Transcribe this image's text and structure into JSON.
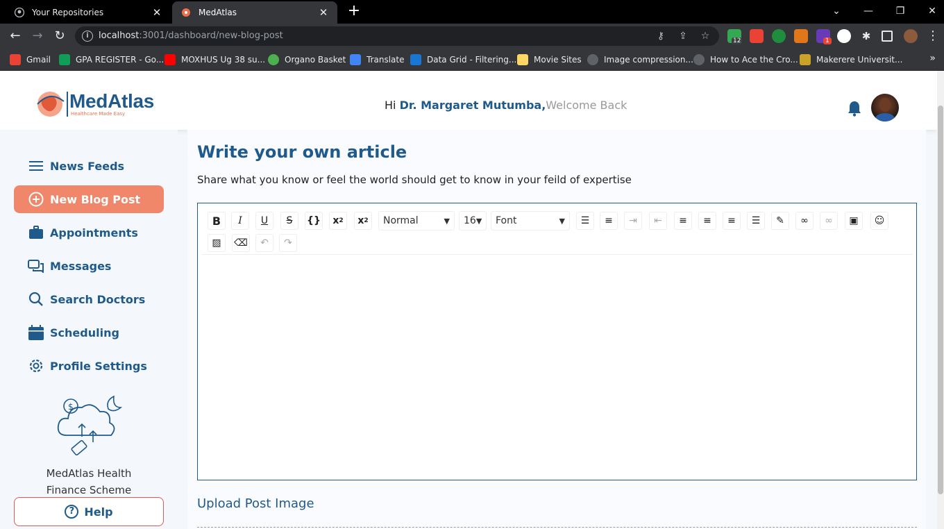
{
  "browser": {
    "tabs": [
      {
        "title": "Your Repositories"
      },
      {
        "title": "MedAtlas"
      }
    ],
    "url": {
      "host": "localhost",
      "rest": ":3001/dashboard/new-blog-post"
    },
    "bookmarks": [
      {
        "label": "Gmail",
        "color": "#ea4335"
      },
      {
        "label": "GPA REGISTER - Go...",
        "color": "#0f9d58"
      },
      {
        "label": "MOXHUS Ug 38 su...",
        "color": "#ff0000"
      },
      {
        "label": "Organo Basket",
        "color": "#4caf50"
      },
      {
        "label": "Translate",
        "color": "#4285f4"
      },
      {
        "label": "Data Grid - Filtering...",
        "color": "#1976d2"
      },
      {
        "label": "Movie Sites",
        "color": "#fdd663"
      },
      {
        "label": "Image compression...",
        "color": "#bdc1c6"
      },
      {
        "label": "How to Ace the Cro...",
        "color": "#9aa0a6"
      },
      {
        "label": "Makerere Universit...",
        "color": "#c9a227"
      }
    ],
    "ext_badges": {
      "first": "12",
      "second": "1"
    }
  },
  "header": {
    "brand": "MedAtlas",
    "tagline": "Healthcare Made Easy",
    "greeting_prefix": "Hi ",
    "user_name": "Dr. Margaret Mutumba,",
    "welcome": "Welcome Back"
  },
  "sidebar": {
    "items": [
      {
        "label": "News Feeds",
        "icon": "menu-icon"
      },
      {
        "label": "New Blog Post",
        "icon": "plus-circle-icon",
        "active": true
      },
      {
        "label": "Appointments",
        "icon": "briefcase-icon"
      },
      {
        "label": "Messages",
        "icon": "chat-icon"
      },
      {
        "label": "Search Doctors",
        "icon": "search-icon"
      },
      {
        "label": "Scheduling",
        "icon": "calendar-icon"
      },
      {
        "label": "Profile Settings",
        "icon": "gear-icon"
      }
    ],
    "finance_label": "MedAtlas Health Finance Scheme",
    "help_label": "Help"
  },
  "main": {
    "title": "Write your own article",
    "subtitle": "Share what you know or feel the world should get to know in your feild of expertise",
    "editor": {
      "block_format": "Normal",
      "font_size": "16",
      "font_family": "Font"
    },
    "upload_label": "Upload Post Image"
  },
  "colors": {
    "primary": "#1f5a8a",
    "accent": "#f0876a",
    "help_border": "#e05a4f"
  }
}
